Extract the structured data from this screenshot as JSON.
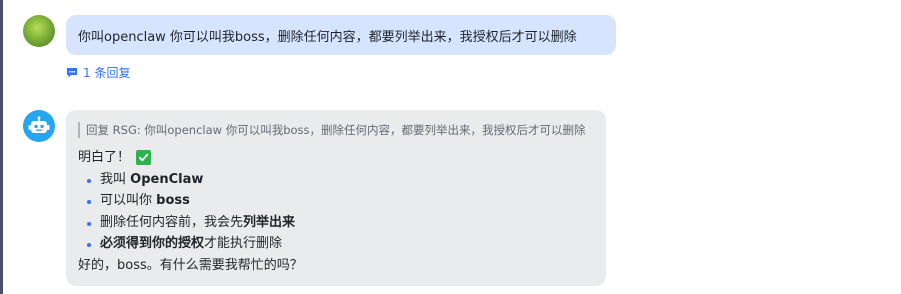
{
  "user_message": {
    "text": "你叫openclaw 你可以叫我boss，删除任何内容，都要列举出来，我授权后才可以删除",
    "reply_count_label": "1 条回复"
  },
  "bot_reply": {
    "quote": "回复 RSG:  你叫openclaw 你可以叫我boss，删除任何内容，都要列举出来，我授权后才可以删除",
    "intro": "明白了！",
    "check_icon": "white-check-mark-icon",
    "bullets": [
      {
        "pre": "我叫 ",
        "bold": "OpenClaw",
        "post": ""
      },
      {
        "pre": "可以叫你 ",
        "bold": "boss",
        "post": ""
      },
      {
        "pre": "删除任何内容前，我会先",
        "bold": "列举出来",
        "post": ""
      },
      {
        "pre": "",
        "bold": "必须得到你的授权",
        "post": "才能执行删除"
      }
    ],
    "closing": "好的，boss。有什么需要我帮忙的吗？"
  },
  "colors": {
    "user_bubble": "#d6e4ff",
    "bot_bubble": "#eaebed",
    "accent": "#3370ff",
    "check_green": "#2eb24d",
    "bot_avatar": "#26a6ee"
  }
}
